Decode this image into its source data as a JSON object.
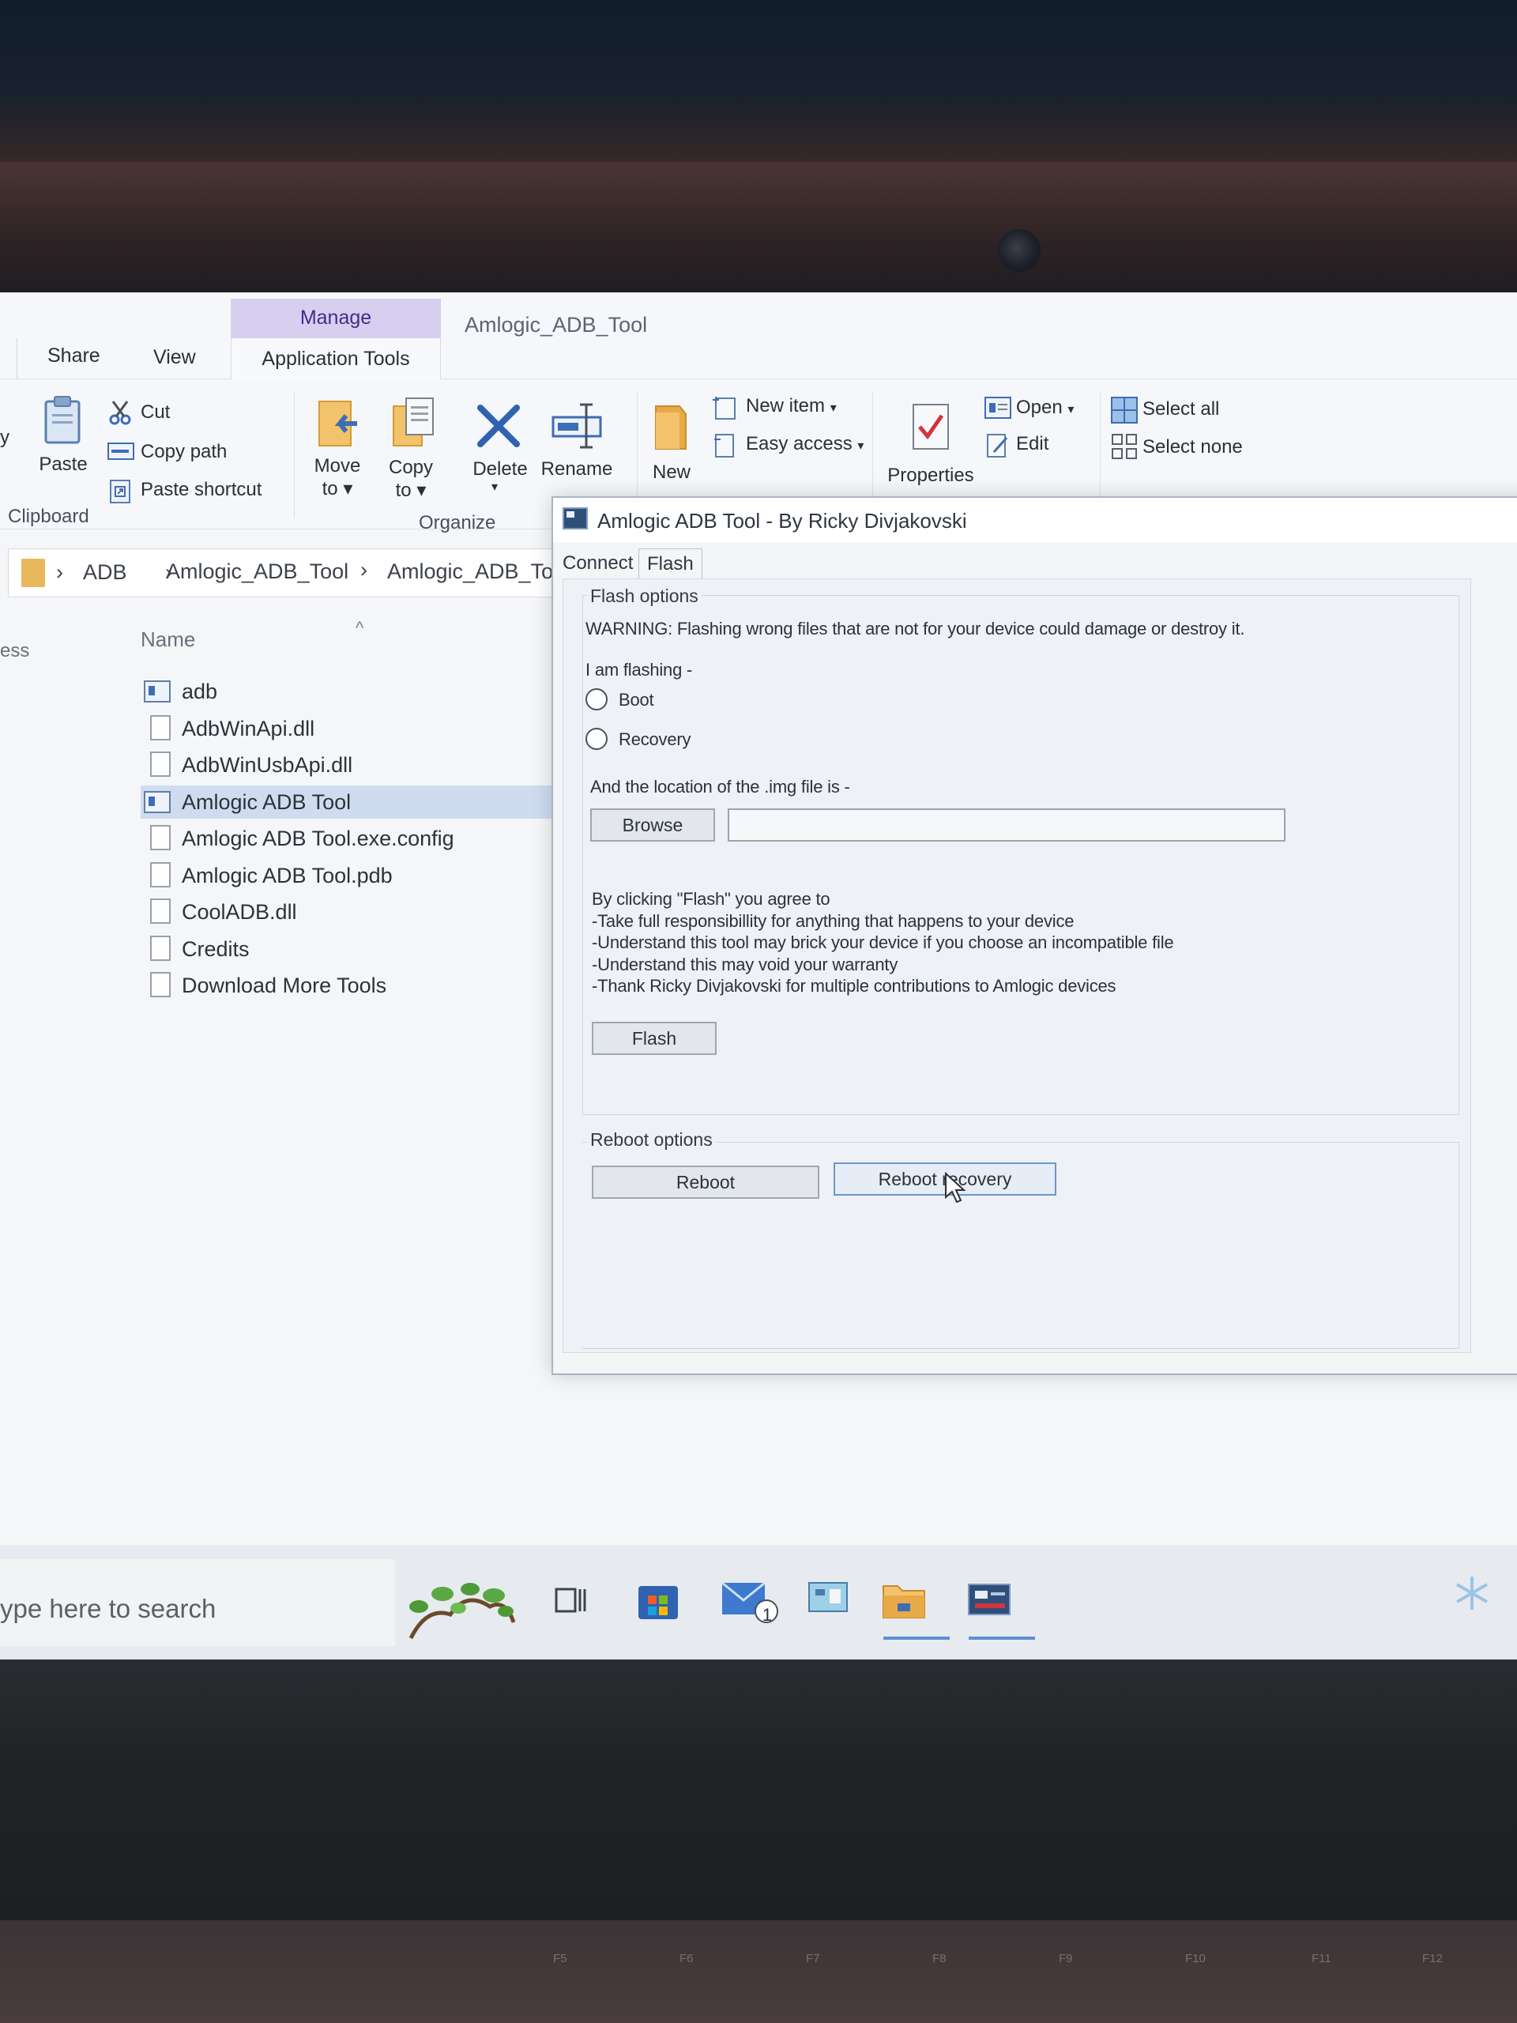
{
  "explorer": {
    "window_title": "Amlogic_ADB_Tool",
    "tabs": {
      "share": "Share",
      "view": "View",
      "manage": "Manage",
      "application_tools": "Application Tools"
    },
    "ribbon": {
      "clipboard": {
        "paste": "Paste",
        "cut": "Cut",
        "copy_path": "Copy path",
        "paste_shortcut": "Paste shortcut",
        "group_label": "Clipboard",
        "left_cut": "y"
      },
      "organize": {
        "move_to": "Move",
        "move_to_2": "to",
        "copy_to": "Copy",
        "copy_to_2": "to",
        "delete": "Delete",
        "rename": "Rename",
        "group_label": "Organize"
      },
      "new": {
        "new_folder": "New",
        "new_item": "New item",
        "easy_access": "Easy access"
      },
      "open": {
        "properties": "Properties",
        "open": "Open",
        "edit": "Edit"
      },
      "select": {
        "select_all": "Select all",
        "select_none": "Select none"
      }
    },
    "address": {
      "parts": [
        "ADB",
        "Amlogic_ADB_Tool",
        "Amlogic_ADB_To"
      ]
    },
    "list": {
      "left_cut": "ess",
      "column_name": "Name",
      "files": [
        {
          "name": "adb",
          "type": "exe"
        },
        {
          "name": "AdbWinApi.dll",
          "type": "file"
        },
        {
          "name": "AdbWinUsbApi.dll",
          "type": "file"
        },
        {
          "name": "Amlogic ADB Tool",
          "type": "exe",
          "selected": true
        },
        {
          "name": "Amlogic ADB Tool.exe.config",
          "type": "file"
        },
        {
          "name": "Amlogic ADB Tool.pdb",
          "type": "file"
        },
        {
          "name": "CoolADB.dll",
          "type": "file"
        },
        {
          "name": "Credits",
          "type": "file"
        },
        {
          "name": "Download More Tools",
          "type": "file"
        }
      ]
    }
  },
  "dialog": {
    "title": "Amlogic ADB Tool - By Ricky Divjakovski",
    "tabs": [
      "Connect",
      "Flash"
    ],
    "active_tab": "Flash",
    "flash_options": {
      "group_title": "Flash options",
      "warning": "WARNING: Flashing wrong files that are not for your device could damage or destroy it.",
      "i_am_flashing": "I am flashing -",
      "radio_boot": "Boot",
      "radio_recovery": "Recovery",
      "location_label": "And the location of the .img file is -",
      "browse_button": "Browse",
      "path_value": "",
      "agreement_lines": [
        "By clicking \"Flash\" you agree to",
        "-Take full responsibillity for anything that happens to your device",
        "-Understand this tool may brick your device if you choose an incompatible file",
        "-Understand this may void your warranty",
        "-Thank Ricky Divjakovski for multiple contributions to Amlogic devices"
      ],
      "flash_button": "Flash"
    },
    "reboot_options": {
      "group_title": "Reboot options",
      "reboot_button": "Reboot",
      "reboot_recovery_button": "Reboot recovery"
    }
  },
  "taskbar": {
    "search_placeholder": "ype here to search",
    "mail_badge": "1"
  },
  "keyboard": {
    "fkeys": [
      "F5",
      "F6",
      "F7",
      "F8",
      "F9",
      "F10",
      "F11",
      "F12"
    ]
  },
  "colors": {
    "manage_tab_bg": "#d8cff0",
    "selection": "#cfdcf0",
    "accent_blue": "#3d6db5"
  }
}
